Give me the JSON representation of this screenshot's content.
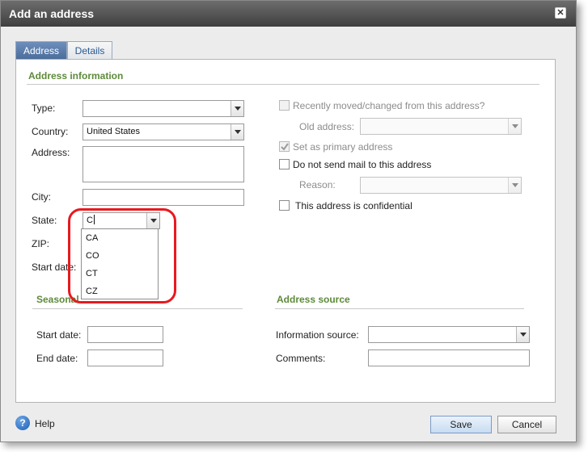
{
  "dialog": {
    "title": "Add an address",
    "close_label": "✕"
  },
  "tabs": [
    {
      "label": "Address",
      "active": true
    },
    {
      "label": "Details",
      "active": false
    }
  ],
  "address_info": {
    "section_title": "Address information",
    "type": {
      "label": "Type:",
      "value": ""
    },
    "country": {
      "label": "Country:",
      "value": "United States"
    },
    "address": {
      "label": "Address:",
      "value": ""
    },
    "city": {
      "label": "City:",
      "value": ""
    },
    "state": {
      "label": "State:",
      "value": "C",
      "options": [
        "CA",
        "CO",
        "CT",
        "CZ"
      ]
    },
    "zip": {
      "label": "ZIP:"
    },
    "start_date": {
      "label": "Start date:"
    }
  },
  "right_options": {
    "recently_moved": {
      "label": "Recently moved/changed from this address?",
      "checked": false,
      "enabled": false
    },
    "old_address": {
      "label": "Old address:",
      "value": ""
    },
    "primary": {
      "label": "Set as primary address",
      "checked": true,
      "enabled": false
    },
    "do_not_mail": {
      "label": "Do not send mail to this address",
      "checked": false,
      "enabled": true
    },
    "reason": {
      "label": "Reason:",
      "value": ""
    },
    "confidential": {
      "label": "This address is confidential",
      "checked": false,
      "enabled": true
    }
  },
  "seasonal": {
    "section_title": "Seasonal",
    "start_date": {
      "label": "Start date:",
      "value": ""
    },
    "end_date": {
      "label": "End date:",
      "value": ""
    }
  },
  "address_source": {
    "section_title": "Address source",
    "info_source": {
      "label": "Information source:",
      "value": ""
    },
    "comments": {
      "label": "Comments:",
      "value": ""
    }
  },
  "footer": {
    "help_label": "Help",
    "help_icon": "question-icon",
    "save_label": "Save",
    "cancel_label": "Cancel"
  },
  "colors": {
    "section_title": "#5e8a3a",
    "active_tab": "#4a6c9b",
    "callout": "#e8191f"
  }
}
